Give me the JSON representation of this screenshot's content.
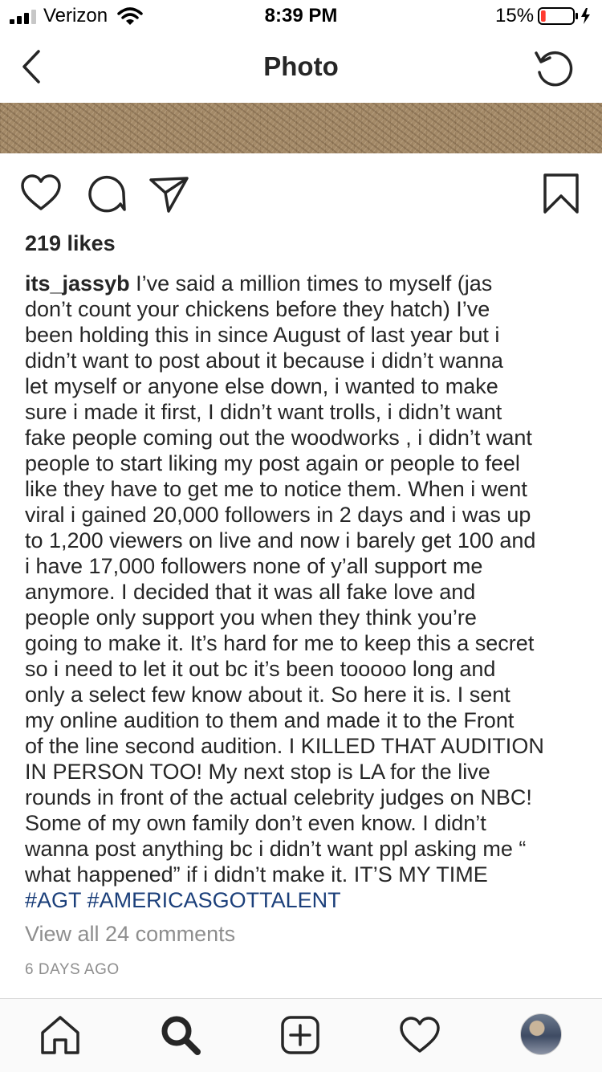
{
  "status_bar": {
    "carrier": "Verizon",
    "time": "8:39 PM",
    "battery_percent": "15%",
    "battery_level": 0.15,
    "battery_color": "#ff3b30",
    "signal_icon": "signal-bars-icon",
    "wifi_icon": "wifi-icon",
    "charging_icon": "charging-bolt-icon"
  },
  "nav": {
    "title": "Photo",
    "back_icon": "chevron-left-icon",
    "refresh_icon": "refresh-icon"
  },
  "post": {
    "likes": "219 likes",
    "username": "its_jassyb",
    "caption_lines": [
      "I’ve said a million times to myself (jas",
      "don’t count your chickens before they hatch) I’ve",
      "been holding this in since August of last year but i",
      "didn’t want to post about it because i didn’t wanna",
      "let myself or anyone else down, i wanted to make",
      "sure i made it first, I didn’t want trolls, i didn’t want",
      "fake people coming out the woodworks , i didn’t want",
      "people to start liking my post again or people to feel",
      "like they have to get me to notice them. When i went",
      "viral i gained 20,000 followers in 2 days and i was up",
      "to 1,200 viewers on live and now i barely get 100 and",
      "i have 17,000 followers none of y’all support me",
      "anymore. I decided that it was all fake love and",
      "people only support you when they think you’re",
      "going to make it. It’s hard for me to keep this a secret",
      "so i need to let it out bc it’s been tooooo long and",
      "only a select few know about it. So here it is. I sent",
      "my online audition to them and made it to the Front",
      "of the line second audition. I KILLED THAT AUDITION",
      "IN PERSON TOO! My next stop is LA for the live",
      "rounds in front of the actual celebrity judges on NBC!",
      "Some of my own family don’t even know. I didn’t",
      "wanna post anything bc i didn’t want ppl asking me “",
      "what happened” if i didn’t make it. IT’S MY TIME"
    ],
    "hashtags": [
      "#AGT",
      "#AMERICASGOTTALENT"
    ],
    "hashtag_color": "#1b3f7a",
    "view_comments": "View all 24 comments",
    "date": "6 DAYS AGO",
    "action_icons": [
      "heart-icon",
      "comment-icon",
      "share-icon",
      "bookmark-icon"
    ]
  },
  "tab_bar": {
    "icons": [
      "home-icon",
      "search-icon",
      "add-post-icon",
      "activity-heart-icon",
      "profile-avatar"
    ]
  }
}
